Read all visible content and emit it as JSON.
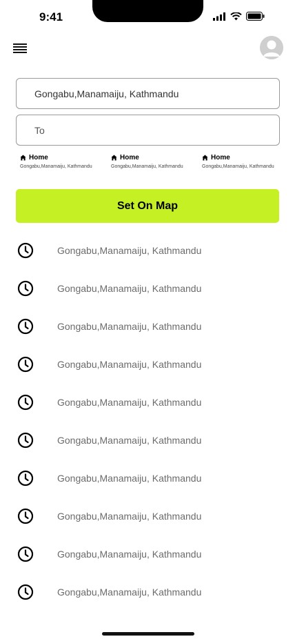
{
  "status_bar": {
    "time": "9:41"
  },
  "search": {
    "from_value": "Gongabu,Manamaiju, Kathmandu",
    "to_placeholder": "To"
  },
  "saved_places": [
    {
      "title": "Home",
      "address": "Gongabu,Manamaiju, Kathmandu"
    },
    {
      "title": "Home",
      "address": "Gongabu,Manamaiju, Kathmandu"
    },
    {
      "title": "Home",
      "address": "Gongabu,Manamaiju, Kathmandu"
    }
  ],
  "set_on_map_label": "Set On Map",
  "history": [
    "Gongabu,Manamaiju, Kathmandu",
    "Gongabu,Manamaiju, Kathmandu",
    "Gongabu,Manamaiju, Kathmandu",
    "Gongabu,Manamaiju, Kathmandu",
    "Gongabu,Manamaiju, Kathmandu",
    "Gongabu,Manamaiju, Kathmandu",
    "Gongabu,Manamaiju, Kathmandu",
    "Gongabu,Manamaiju, Kathmandu",
    "Gongabu,Manamaiju, Kathmandu",
    "Gongabu,Manamaiju, Kathmandu"
  ],
  "icons": {
    "menu": "menu-icon",
    "avatar": "user-avatar-icon",
    "home": "home-icon",
    "history": "clock-icon"
  },
  "colors": {
    "accent": "#c5f023",
    "history_text": "#6b6b6b",
    "field_border": "#9a9a9a"
  }
}
